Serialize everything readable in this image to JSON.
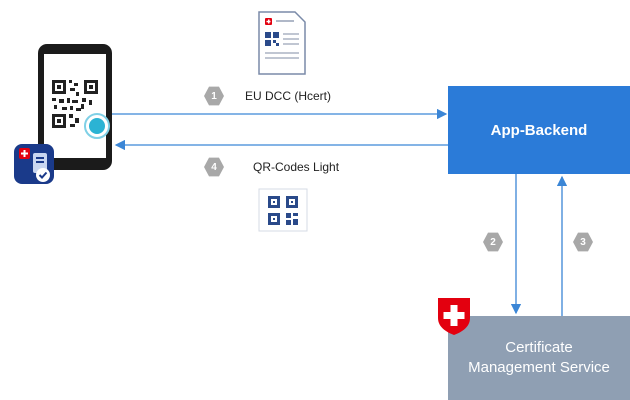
{
  "nodes": {
    "backend": "App-Backend",
    "cms_line1": "Certificate",
    "cms_line2": "Management Service"
  },
  "flows": [
    {
      "step": "1",
      "label": "EU DCC (Hcert)"
    },
    {
      "step": "2",
      "label": ""
    },
    {
      "step": "3",
      "label": ""
    },
    {
      "step": "4",
      "label": "QR-Codes Light"
    }
  ],
  "colors": {
    "arrow": "#3b86d6",
    "backend": "#2b7bd8",
    "cms": "#8f9fb3",
    "swiss_red": "#e3000f",
    "badge": "#a8a8a8"
  }
}
